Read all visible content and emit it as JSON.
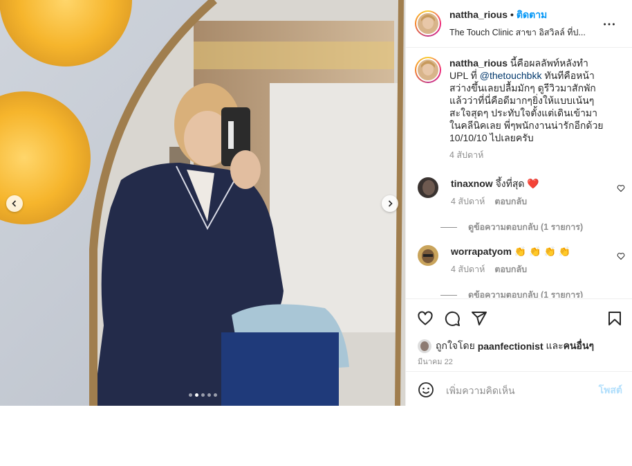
{
  "header": {
    "username": "nattha_rious",
    "separator": "•",
    "follow_label": "ติดตาม",
    "location": "The Touch Clinic สาขา อิสวิลล์ ที่ป..."
  },
  "caption": {
    "username": "nattha_rious",
    "text_before_mention": "นี้คือผลลัพท์หลังทำ UPL ที่",
    "mention": "@thetouchbkk",
    "text_after_mention": "ทันทีคือหน้าสว่างขึ้นเลยปลื้มมักๆ ดูรีวิวมาสักพักแล้วว่าที่นี่คือดีมากๆยิ่งให้แบบเน้นๆ สะใจสุดๆ ประทับใจตั้งแต่เดินเข้ามาในคลีนิคเลย พี่ๆพนักงานน่ารักอีกด้วย 10/10/10 ไปเลยครับ",
    "time": "4 สัปดาห์"
  },
  "comments": [
    {
      "username": "tinaxnow",
      "text": "จึ้งที่สุด ❤️",
      "time": "4 สัปดาห์",
      "reply_label": "ตอบกลับ",
      "view_replies": "ดูข้อความตอบกลับ (1 รายการ)"
    },
    {
      "username": "worrapatyom",
      "text": "👏 👏 👏 👏",
      "time": "4 สัปดาห์",
      "reply_label": "ตอบกลับ",
      "view_replies": "ดูข้อความตอบกลับ (1 รายการ)"
    }
  ],
  "likes": {
    "prefix": "ถูกใจโดย",
    "user": "paanfectionist",
    "conjunction": "และ",
    "others": "คนอื่นๆ"
  },
  "date": "มีนาคม 22",
  "add_comment": {
    "placeholder": "เพิ่มความคิดเห็น",
    "post_label": "โพสต์"
  },
  "carousel": {
    "count": 5,
    "active": 1
  },
  "colors": {
    "accent": "#0095f6",
    "text": "#262626",
    "muted": "#8e8e8e",
    "border": "#efefef",
    "heart_red": "#ed4956"
  },
  "icons": [
    "more-icon",
    "heart-icon",
    "comment-icon",
    "share-icon",
    "bookmark-icon",
    "emoji-icon",
    "chevron-left-icon",
    "chevron-right-icon"
  ]
}
